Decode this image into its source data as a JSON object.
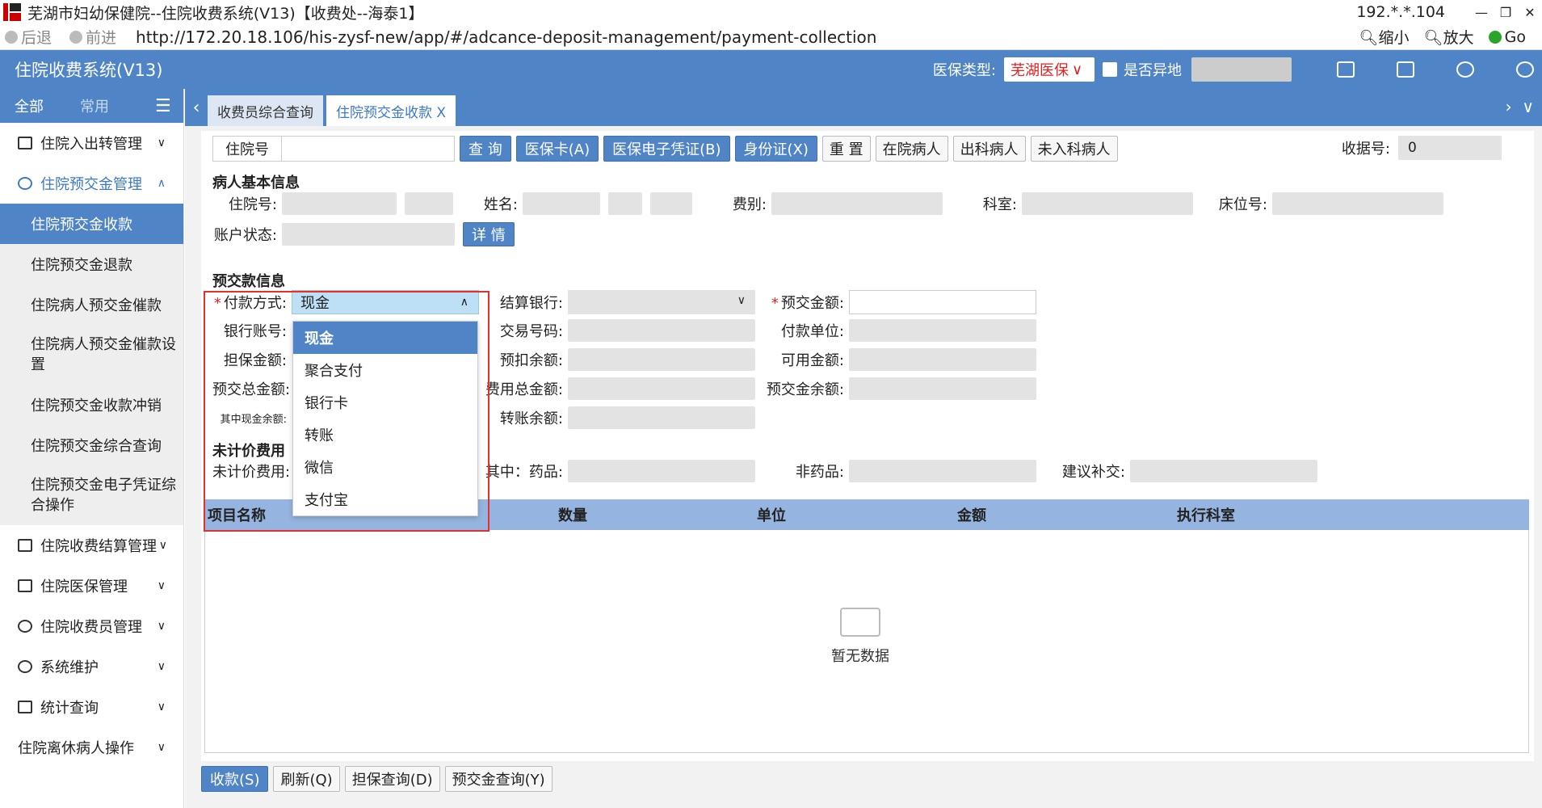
{
  "window": {
    "title": "芜湖市妇幼保健院--住院收费系统(V13)【收费处--海泰1】",
    "ip": "192.*.*.104",
    "controls": [
      "—",
      "❐",
      "✕"
    ]
  },
  "browser": {
    "back": "后退",
    "forward": "前进",
    "url": "http://172.20.18.106/his-zysf-new/app/#/adcance-deposit-management/payment-collection",
    "zoom_out": "缩小",
    "zoom_in": "放大",
    "go": "Go"
  },
  "header": {
    "app_title": "住院收费系统(V13)",
    "insurance_label": "医保类型:",
    "insurance_value": "芜湖医保",
    "remote_label": "是否异地"
  },
  "sidebar": {
    "tab_all": "全部",
    "tab_common": "常用",
    "menu_icon": "☰",
    "items": [
      {
        "label": "住院入出转管理"
      },
      {
        "label": "住院预交金管理"
      },
      {
        "label": "住院收费结算管理"
      },
      {
        "label": "住院医保管理"
      },
      {
        "label": "住院收费员管理"
      },
      {
        "label": "系统维护"
      },
      {
        "label": "统计查询"
      },
      {
        "label": "住院离休病人操作"
      }
    ],
    "subitems": [
      {
        "label": "住院预交金收款"
      },
      {
        "label": "住院预交金退款"
      },
      {
        "label": "住院病人预交金催款"
      },
      {
        "label": "住院病人预交金催款设置"
      },
      {
        "label": "住院预交金收款冲销"
      },
      {
        "label": "住院预交金综合查询"
      },
      {
        "label": "住院预交金电子凭证综合操作"
      }
    ]
  },
  "tabs": [
    {
      "label": "收费员综合查询"
    },
    {
      "label": "住院预交金收款 X"
    }
  ],
  "search": {
    "id_label": "住院号",
    "buttons": [
      "查 询",
      "医保卡(A)",
      "医保电子凭证(B)",
      "身份证(X)"
    ],
    "white_buttons": [
      "重 置",
      "在院病人",
      "出科病人",
      "未入科病人"
    ],
    "receipt_label": "收据号:",
    "receipt_value": "0"
  },
  "patient": {
    "title": "病人基本信息",
    "labels": {
      "id": "住院号:",
      "name": "姓名:",
      "fee": "费别:",
      "dept": "科室:",
      "bed": "床位号:",
      "acct": "账户状态:"
    },
    "detail_button": "详 情"
  },
  "deposit": {
    "title": "预交款信息",
    "pay_method_label": "付款方式:",
    "pay_method_value": "现金",
    "bank_label": "结算银行:",
    "amount_label": "预交金额:",
    "account_label": "银行账号:",
    "trade_label": "交易号码:",
    "payer_label": "付款单位:",
    "guarantee_label": "担保金额:",
    "deduct_label": "预扣余额:",
    "available_label": "可用金额:",
    "total_label": "预交总金额:",
    "cost_total_label": "费用总金额:",
    "balance_label": "预交金余额:",
    "cash_balance_label": "其中现金余额:",
    "transfer_label": "转账余额:",
    "options": [
      "现金",
      "聚合支付",
      "银行卡",
      "转账",
      "微信",
      "支付宝"
    ]
  },
  "unbilled": {
    "title": "未计价费用",
    "fee_label": "未计价费用:",
    "drug_label": "其中：药品:",
    "nondrug_label": "非药品:",
    "suggest_label": "建议补交:"
  },
  "table": {
    "columns": [
      "项目名称",
      "数量",
      "单位",
      "金额",
      "执行科室"
    ],
    "empty": "暂无数据"
  },
  "bottom_buttons": [
    {
      "label": "收款(S)",
      "primary": true
    },
    {
      "label": "刷新(Q)"
    },
    {
      "label": "担保查询(D)"
    },
    {
      "label": "预交金查询(Y)"
    }
  ],
  "colors": {
    "accent": "#4f84c7",
    "highlight": "#e53030",
    "insurance": "#e02020"
  }
}
